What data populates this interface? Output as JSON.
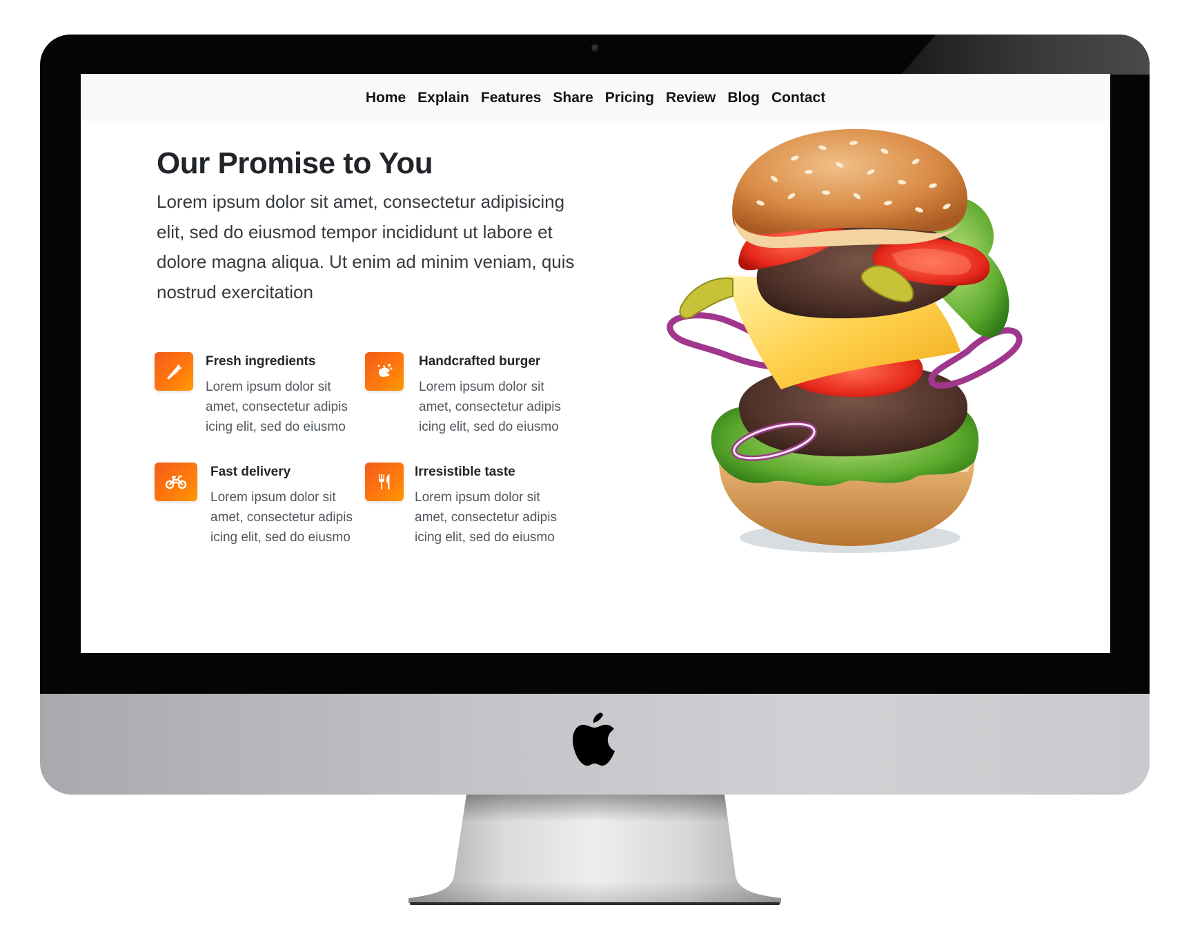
{
  "nav": {
    "items": [
      "Home",
      "Explain",
      "Features",
      "Share",
      "Pricing",
      "Review",
      "Blog",
      "Contact"
    ]
  },
  "hero": {
    "title": "Our Promise to You",
    "intro": "Lorem ipsum dolor sit amet, consectetur adipisicing elit, sed do eiusmod tempor incididunt ut labore et dolore magna aliqua. Ut enim ad minim veniam, quis nostrud exercitation"
  },
  "features": [
    {
      "title": "Fresh ingredients",
      "text": "Lorem ipsum dolor sit amet, consectetur adipis icing elit, sed do eiusmo",
      "icon": "carrot-icon"
    },
    {
      "title": "Handcrafted burger",
      "text": "Lorem ipsum dolor sit amet, consectetur adipis icing elit, sed do eiusmo",
      "icon": "hand-wash-icon"
    },
    {
      "title": "Fast delivery",
      "text": "Lorem ipsum dolor sit amet, consectetur adipis icing elit, sed do eiusmo",
      "icon": "motorcycle-icon"
    },
    {
      "title": "Irresistible taste",
      "text": "Lorem ipsum dolor sit amet, consectetur adipis icing elit, sed do eiusmo",
      "icon": "utensils-icon"
    }
  ],
  "colors": {
    "accent": "#ff6a13",
    "nav_bg": "#f8f9fa",
    "heading": "#212529"
  }
}
